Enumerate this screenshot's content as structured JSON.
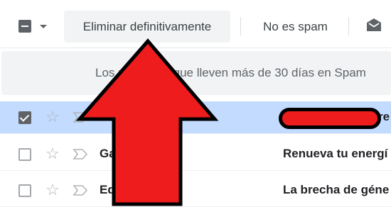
{
  "toolbar": {
    "delete_forever_label": "Eliminar definitivamente",
    "not_spam_label": "No es spam",
    "icons": [
      "checkbox-minus-icon",
      "chevron-down-icon",
      "envelope-open-icon"
    ]
  },
  "banner": {
    "text": "Los mensajes que lleven más de 30 días en Spam"
  },
  "rows": [
    {
      "selected": true,
      "sender": "A",
      "subject": "re"
    },
    {
      "selected": false,
      "sender": "Ga        os vía.",
      "subject": "Renueva tu energí"
    },
    {
      "selected": false,
      "sender": "Ed",
      "subject": "La brecha de géne"
    }
  ],
  "colors": {
    "selected_row": "#c2dbff",
    "annotation_arrow": "#ee1c1c",
    "toolbar_button_bg": "#f1f3f4"
  }
}
